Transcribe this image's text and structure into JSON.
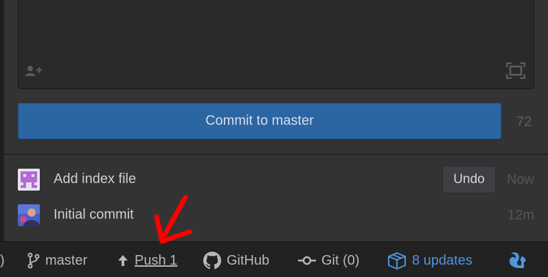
{
  "commit_button": {
    "label": "Commit to master"
  },
  "char_count": "72",
  "recent_commits": [
    {
      "title": "Add index file",
      "action": "Undo",
      "time": "Now"
    },
    {
      "title": "Initial commit",
      "time": "12m"
    }
  ],
  "status_bar": {
    "edge_glyph": ")",
    "branch": "master",
    "push": "Push 1",
    "github": "GitHub",
    "git": "Git (0)",
    "updates": "8 updates"
  },
  "colors": {
    "accent": "#2b66a3",
    "updates": "#4e95de",
    "annotation": "#ff0000"
  },
  "icons": [
    "add-coauthor-icon",
    "expand-icon",
    "git-branch-icon",
    "arrow-up-icon",
    "github-icon",
    "git-commit-icon",
    "package-icon",
    "squirrel-icon"
  ]
}
